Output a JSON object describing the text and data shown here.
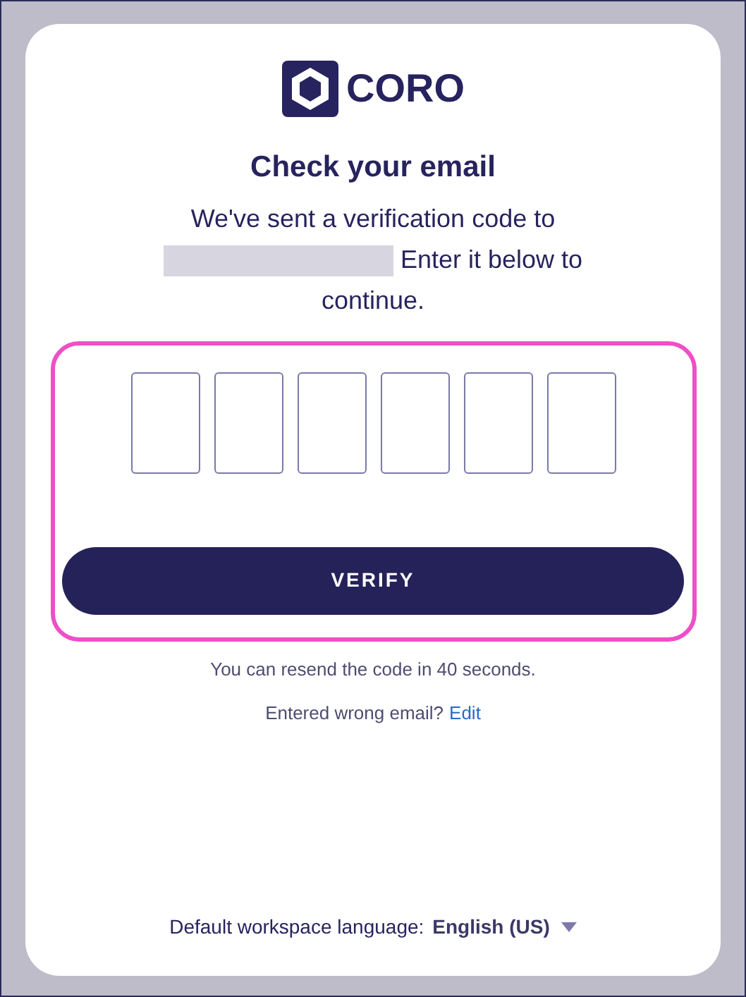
{
  "logo": {
    "text": "CORO"
  },
  "title": "Check your email",
  "message": {
    "before": "We've sent a verification code to",
    "after": "Enter it below to continue."
  },
  "code_inputs": [
    {
      "kind": "digit"
    },
    {
      "kind": "digit"
    },
    {
      "kind": "digit"
    },
    {
      "kind": "digit"
    },
    {
      "kind": "digit"
    },
    {
      "kind": "digit"
    }
  ],
  "verify_button": "VERIFY",
  "resend_text": "You can resend the code in 40 seconds.",
  "wrong_email": {
    "text": "Entered wrong email?",
    "link": "Edit"
  },
  "language": {
    "label": "Default workspace language:",
    "value": "English (US)"
  }
}
